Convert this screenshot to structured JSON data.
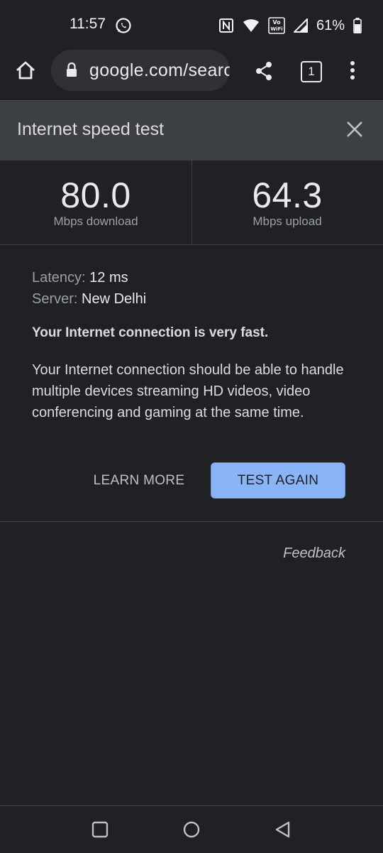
{
  "status_bar": {
    "time": "11:57",
    "battery": "61%",
    "icons": [
      "whatsapp-icon",
      "nfc-icon",
      "wifi-icon",
      "vowifi-icon",
      "signal-icon",
      "battery-icon"
    ]
  },
  "toolbar": {
    "url": "google.com/search",
    "tab_count": "1",
    "icons": [
      "home-icon",
      "lock-icon",
      "share-icon",
      "tab-switcher-icon",
      "more-icon"
    ]
  },
  "speed_test": {
    "title": "Internet speed test",
    "download": {
      "value": "80.0",
      "label": "Mbps download"
    },
    "upload": {
      "value": "64.3",
      "label": "Mbps upload"
    },
    "latency": {
      "label": "Latency:",
      "value": "12 ms"
    },
    "server": {
      "label": "Server:",
      "value": "New Delhi"
    },
    "verdict": "Your Internet connection is very fast.",
    "description": "Your Internet connection should be able to handle multiple devices streaming HD videos, video conferencing and gaming at the same time.",
    "learn_more": "LEARN MORE",
    "test_again": "TEST AGAIN",
    "feedback": "Feedback"
  },
  "colors": {
    "background": "#202124",
    "header": "#3c4043",
    "accent": "#8ab4f8"
  }
}
